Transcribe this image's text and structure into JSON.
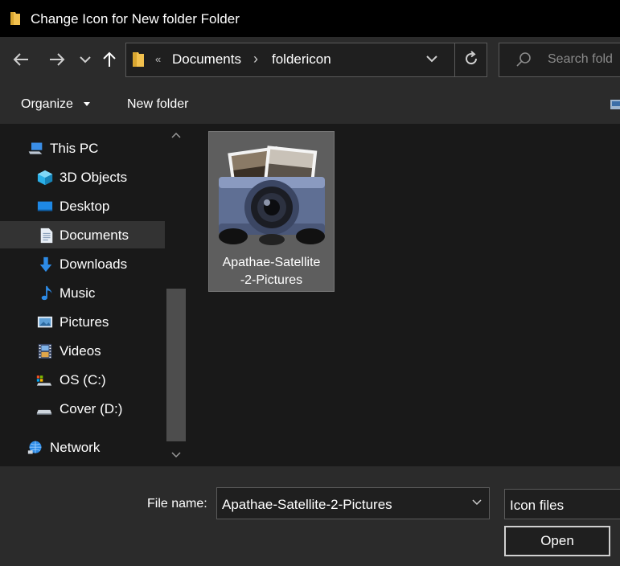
{
  "window": {
    "title": "Change Icon for New folder Folder"
  },
  "nav": {
    "address": {
      "overflow": "«",
      "crumbs": [
        "Documents",
        "foldericon"
      ]
    },
    "search_placeholder": "Search fold"
  },
  "toolbar": {
    "organize": "Organize",
    "new_folder": "New folder"
  },
  "sidebar": {
    "items": [
      {
        "label": "This PC",
        "icon": "computer-icon"
      },
      {
        "label": "3D Objects",
        "icon": "cube-icon"
      },
      {
        "label": "Desktop",
        "icon": "desktop-icon"
      },
      {
        "label": "Documents",
        "icon": "document-icon",
        "selected": true
      },
      {
        "label": "Downloads",
        "icon": "download-arrow-icon"
      },
      {
        "label": "Music",
        "icon": "music-note-icon"
      },
      {
        "label": "Pictures",
        "icon": "picture-icon"
      },
      {
        "label": "Videos",
        "icon": "film-icon"
      },
      {
        "label": "OS (C:)",
        "icon": "drive-icon"
      },
      {
        "label": "Cover (D:)",
        "icon": "drive-icon"
      },
      {
        "label": "Network",
        "icon": "network-icon"
      }
    ]
  },
  "files": [
    {
      "name_line1": "Apathae-Satellite",
      "name_line2": "-2-Pictures",
      "icon": "camera-photos-icon"
    }
  ],
  "footer": {
    "file_name_label": "File name:",
    "file_name_value": "Apathae-Satellite-2-Pictures",
    "file_type_value": "Icon files",
    "open_label": "Open"
  },
  "colors": {
    "background": "#191919",
    "panel": "#2b2b2b",
    "selection": "#333333",
    "titlebar": "#000000"
  }
}
